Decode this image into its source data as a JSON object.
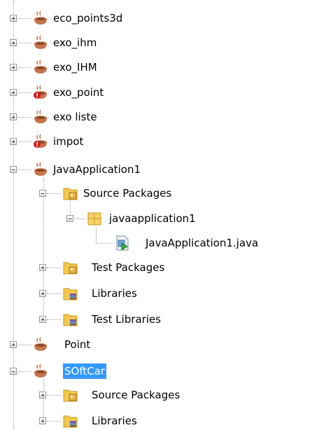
{
  "tree": {
    "nodes": [
      {
        "label": "eco_points3d",
        "icon": "java-project-icon",
        "state": "collapsed",
        "level": 0
      },
      {
        "label": "exo_ihm",
        "icon": "java-project-icon",
        "state": "collapsed",
        "level": 0
      },
      {
        "label": "exo_IHM",
        "icon": "java-project-icon",
        "state": "collapsed",
        "level": 0
      },
      {
        "label": "exo_point",
        "icon": "java-project-error-icon",
        "state": "collapsed",
        "level": 0
      },
      {
        "label": "exo liste",
        "icon": "java-project-icon",
        "state": "collapsed",
        "level": 0
      },
      {
        "label": "impot",
        "icon": "java-project-error-icon",
        "state": "collapsed",
        "level": 0
      },
      {
        "label": "JavaApplication1",
        "icon": "java-project-icon",
        "state": "expanded",
        "level": 0
      },
      {
        "label": "Source Packages",
        "icon": "source-packages-folder-icon",
        "state": "expanded",
        "level": 1
      },
      {
        "label": "javaapplication1",
        "icon": "package-icon",
        "state": "expanded",
        "level": 2
      },
      {
        "label": "JavaApplication1.java",
        "icon": "java-main-class-file-icon",
        "state": "leaf",
        "level": 3
      },
      {
        "label": "Test Packages",
        "icon": "test-packages-folder-icon",
        "state": "collapsed",
        "level": 1
      },
      {
        "label": "Libraries",
        "icon": "libraries-folder-icon",
        "state": "collapsed",
        "level": 1
      },
      {
        "label": "Test Libraries",
        "icon": "libraries-folder-icon",
        "state": "collapsed",
        "level": 1
      },
      {
        "label": "Point",
        "icon": "java-project-icon",
        "state": "collapsed",
        "level": 0
      },
      {
        "label": "SOftCar",
        "icon": "java-project-icon",
        "state": "expanded",
        "level": 0,
        "selected": true
      },
      {
        "label": "Source Packages",
        "icon": "source-packages-folder-icon",
        "state": "collapsed",
        "level": 1
      },
      {
        "label": "Libraries",
        "icon": "libraries-folder-icon",
        "state": "collapsed",
        "level": 1
      }
    ]
  }
}
